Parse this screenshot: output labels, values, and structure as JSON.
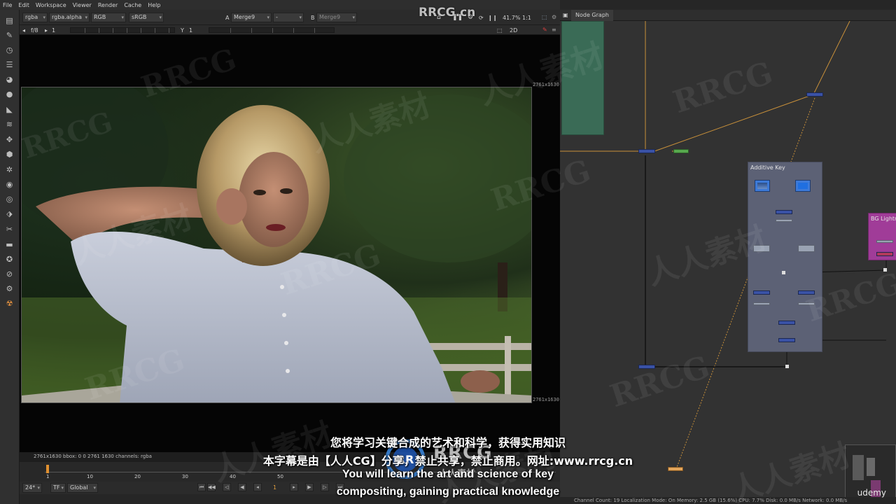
{
  "menubar": {
    "items": [
      "File",
      "Edit",
      "Workspace",
      "Viewer",
      "Render",
      "Cache",
      "Help"
    ]
  },
  "viewer": {
    "channels": "rgba",
    "layer": "rgba.alpha",
    "colorspace": "RGB",
    "display": "sRGB",
    "input_a_label": "A",
    "input_a": "Merge9",
    "mode": "-",
    "input_b_label": "B",
    "input_b": "Merge9",
    "zoom": "41.7%",
    "ratio": "1:1",
    "fstop_label": "f/8",
    "frame_label": "1",
    "y_label": "Y",
    "y_value": "1",
    "view_mode": "2D",
    "resolution_label": "2761x1630",
    "status_text": "2761x1630  bbox: 0 0 2761 1630 channels: rgba",
    "frame_field": "24*",
    "tf_label": "TF",
    "global_label": "Global",
    "current_frame": "1",
    "timeline_ticks": [
      "1",
      "10",
      "20",
      "30",
      "40",
      "50"
    ]
  },
  "node_graph": {
    "tab": "Node Graph",
    "backdrops": [
      "Additive Key",
      "BG Lightn"
    ],
    "status": "Channel Count: 19  Localization Mode: On  Memory: 2.5 GB (15.6%)  CPU: 7.7%  Disk: 0.0 MB/s  Network: 0.0 MB/s"
  },
  "subtitles": {
    "line1": "您将学习关键合成的艺术和科学，获得实用知识",
    "line2": "本字幕是由【人人CG】分享，禁止共享，禁止商用。网址:www.rrcg.cn",
    "line3": "You will learn the art and science of key",
    "line4": "compositing, gaining practical knowledge"
  },
  "branding": {
    "top_watermark": "RRCG.cn",
    "logo_text": "RRCG",
    "logo_sub": "人人素材",
    "udemy": "udemy",
    "watermark_text": "RRCG",
    "watermark_cn": "人人素材"
  },
  "colors": {
    "backdrop_teal": "#3a6b56",
    "backdrop_additive": "#5c6175",
    "backdrop_bg_light": "#a03c98",
    "node_blue": "#3a52a6",
    "pipe_orange": "#c8903a"
  },
  "icons": [
    "pointer-icon",
    "paint-icon",
    "time-icon",
    "channel-icon",
    "color-icon",
    "filter-icon",
    "draw-icon",
    "keyer-icon",
    "merge-icon",
    "transform-icon",
    "3d-icon",
    "particles-icon",
    "deep-icon",
    "views-icon",
    "metadata-icon",
    "toolsets-icon",
    "other-icon",
    "furnace-icon",
    "nuke-icon"
  ]
}
